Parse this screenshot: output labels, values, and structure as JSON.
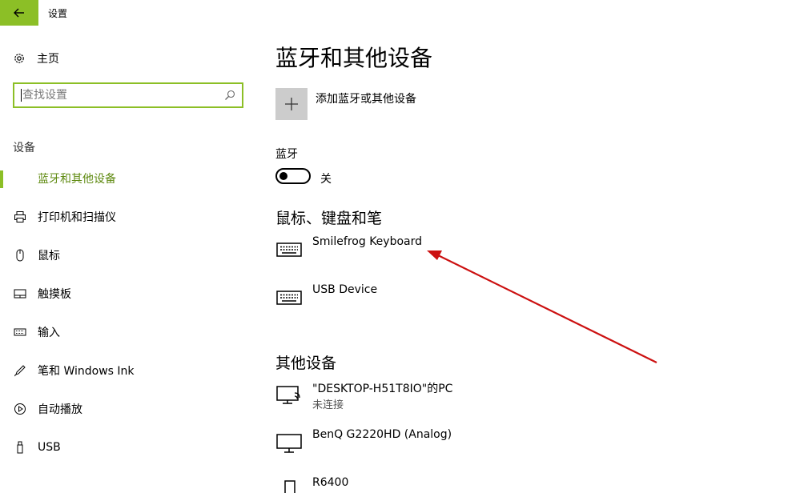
{
  "window": {
    "title": "设置"
  },
  "sidebar": {
    "home_label": "主页",
    "search": {
      "placeholder": "查找设置"
    },
    "section_label": "设备",
    "items": [
      {
        "label": "蓝牙和其他设备",
        "icon": "bluetooth-devices-icon",
        "active": true
      },
      {
        "label": "打印机和扫描仪",
        "icon": "printer-icon",
        "active": false
      },
      {
        "label": "鼠标",
        "icon": "mouse-icon",
        "active": false
      },
      {
        "label": "触摸板",
        "icon": "touchpad-icon",
        "active": false
      },
      {
        "label": "输入",
        "icon": "keyboard-icon",
        "active": false
      },
      {
        "label": "笔和 Windows Ink",
        "icon": "pen-icon",
        "active": false
      },
      {
        "label": "自动播放",
        "icon": "autoplay-icon",
        "active": false
      },
      {
        "label": "USB",
        "icon": "usb-icon",
        "active": false
      }
    ]
  },
  "main": {
    "title": "蓝牙和其他设备",
    "add_device_label": "添加蓝牙或其他设备",
    "bluetooth": {
      "label": "蓝牙",
      "state": "关"
    },
    "input_group": {
      "heading": "鼠标、键盘和笔",
      "devices": [
        {
          "name": "Smilefrog Keyboard",
          "icon": "keyboard-icon"
        },
        {
          "name": "USB Device",
          "icon": "keyboard-icon"
        }
      ]
    },
    "other_group": {
      "heading": "其他设备",
      "devices": [
        {
          "name": "\"DESKTOP-H51T8IO\"的PC",
          "status": "未连接",
          "icon": "pc-network-icon"
        },
        {
          "name": "BenQ G2220HD (Analog)",
          "icon": "monitor-icon"
        },
        {
          "name": "R6400",
          "icon": "phone-icon"
        }
      ]
    }
  },
  "colors": {
    "accent": "#8cbf26",
    "accent_text": "#5f8a11",
    "annotation": "#cc1111"
  }
}
